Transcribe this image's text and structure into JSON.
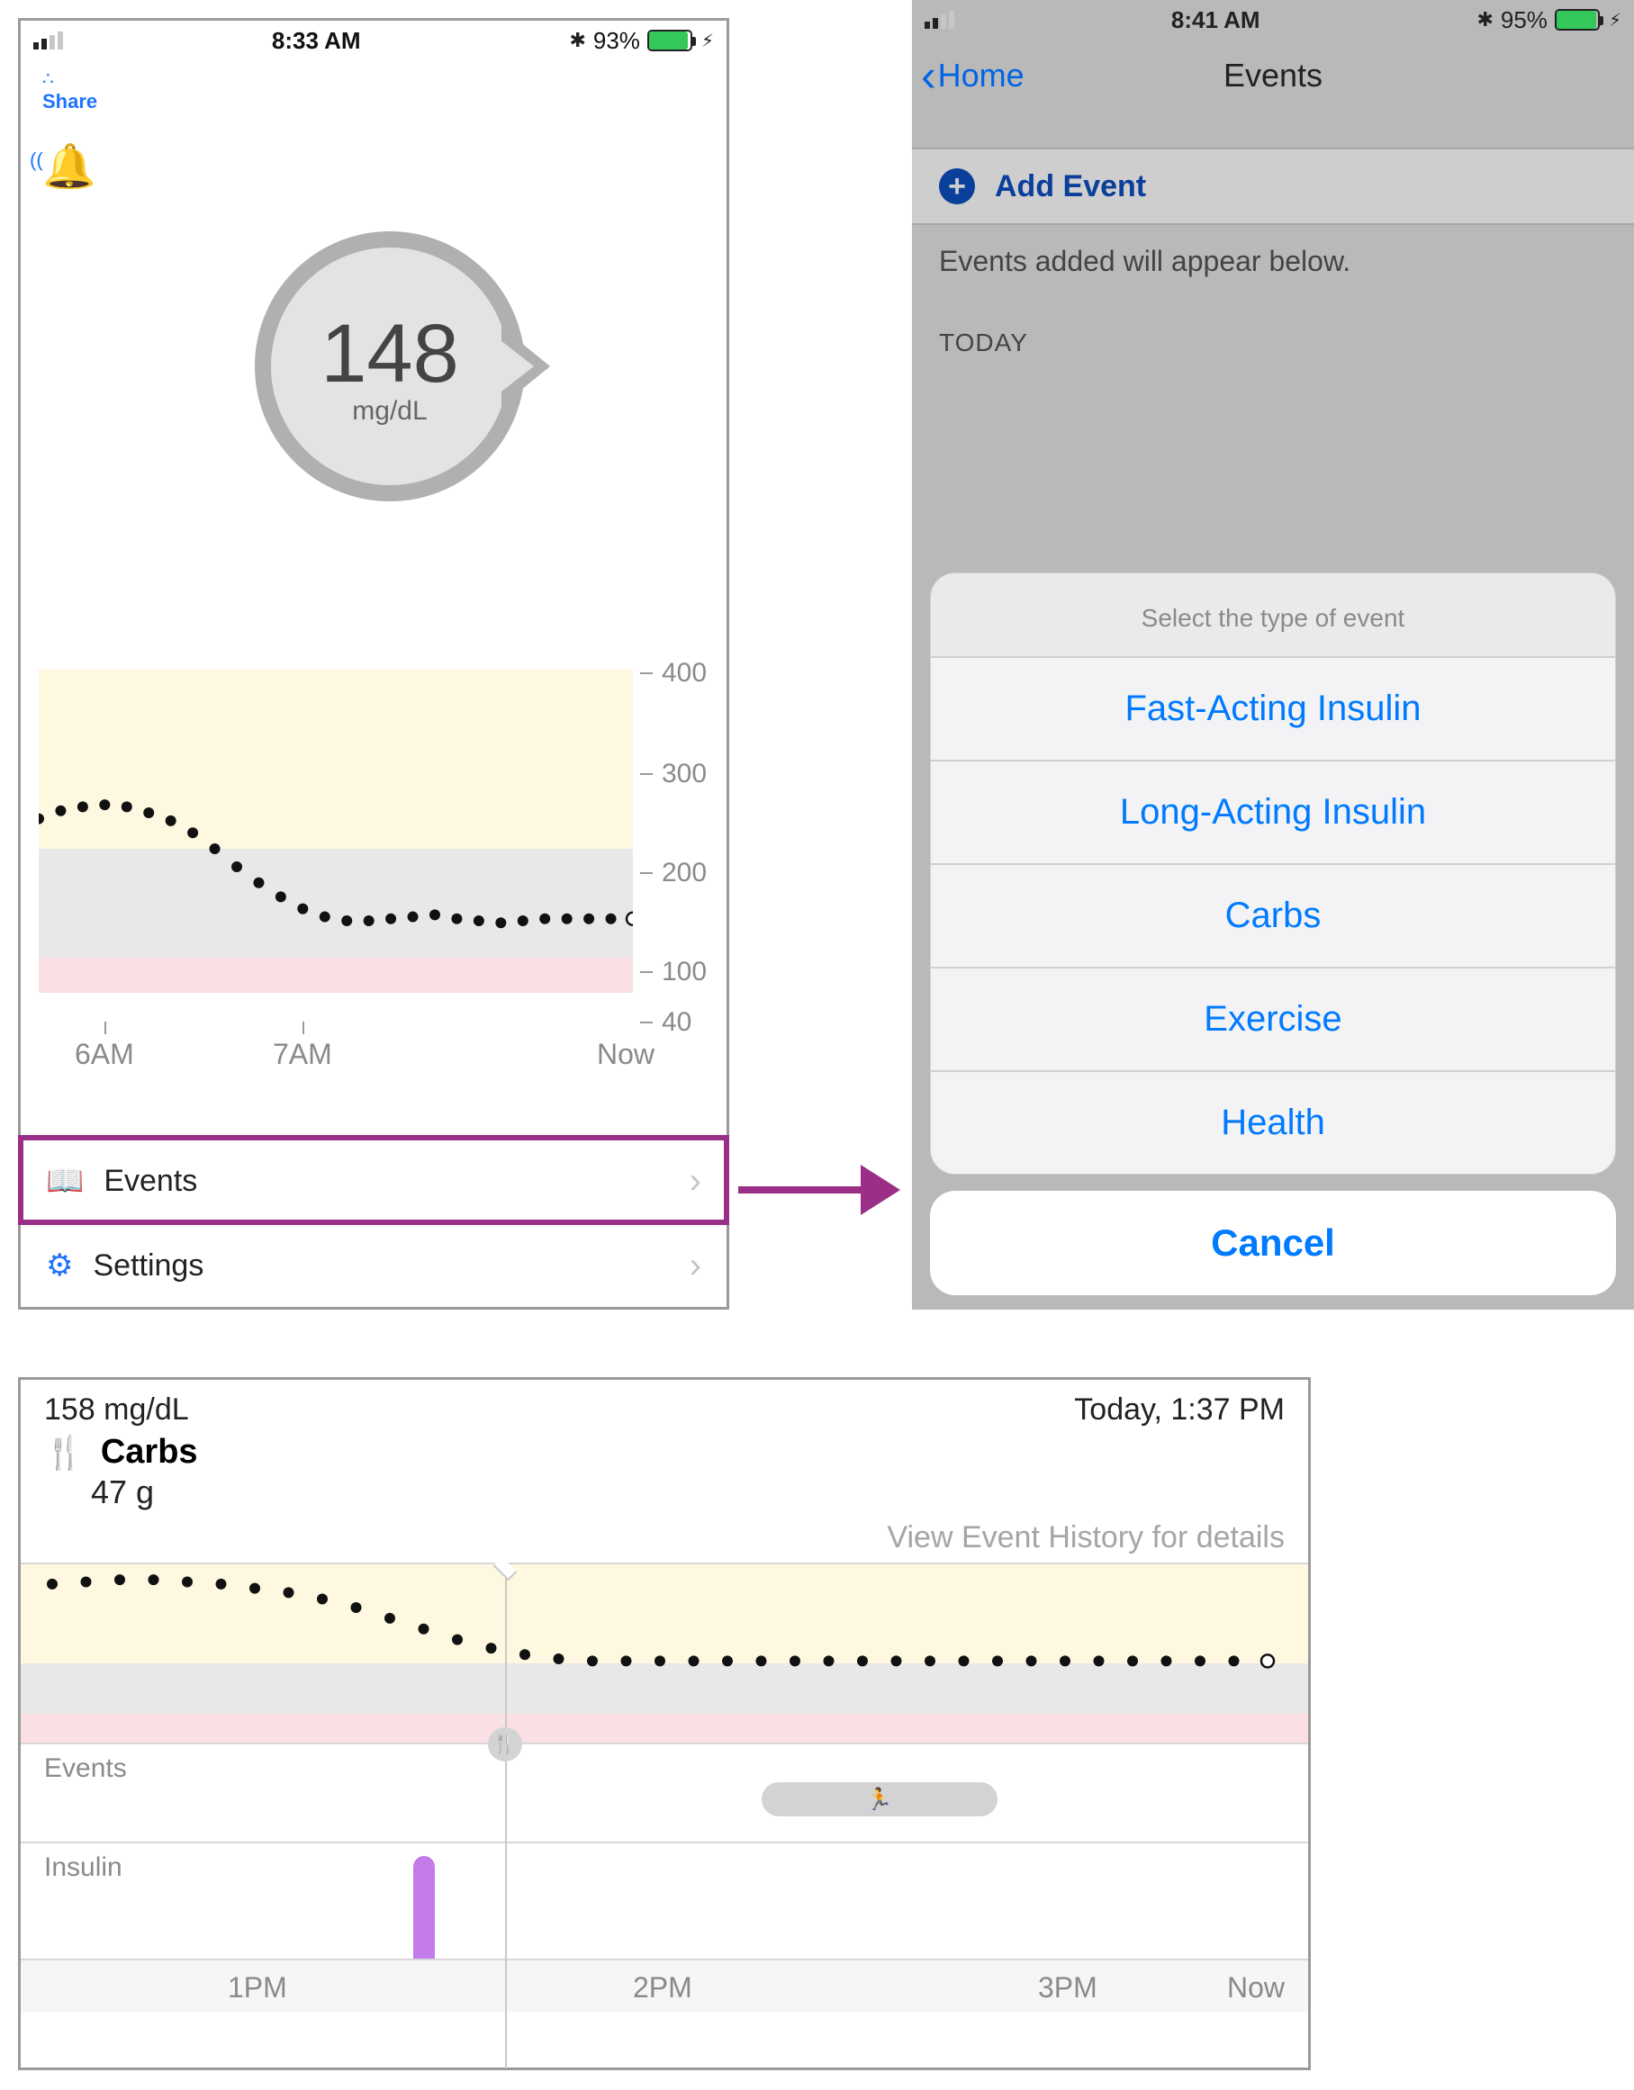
{
  "screen1": {
    "statusbar": {
      "time": "8:33 AM",
      "battery_pct": "93%",
      "battery_fill_pct": 93,
      "bluetooth": "✱"
    },
    "share_label": "Share",
    "gauge": {
      "value": "148",
      "unit": "mg/dL"
    },
    "menu": {
      "events": "Events",
      "settings": "Settings"
    }
  },
  "chart_data": [
    {
      "id": "home_trend",
      "type": "line",
      "title": "",
      "ylabel": "mg/dL",
      "ylim": [
        40,
        400
      ],
      "y_ticks": [
        40,
        100,
        200,
        300,
        400
      ],
      "x_ticks": [
        "6AM",
        "7AM",
        "Now"
      ],
      "zones": {
        "high_above": 200,
        "target": [
          100,
          200
        ],
        "low_below": 80
      },
      "series": [
        {
          "name": "glucose",
          "x_minutes_from_6am": [
            0,
            5,
            10,
            15,
            20,
            25,
            30,
            35,
            40,
            45,
            50,
            55,
            60,
            65,
            70,
            75,
            80,
            85,
            90,
            95,
            100,
            105,
            110,
            115,
            120,
            125,
            130,
            135
          ],
          "values": [
            250,
            258,
            262,
            264,
            262,
            256,
            248,
            236,
            220,
            202,
            186,
            172,
            160,
            152,
            148,
            148,
            150,
            152,
            154,
            150,
            148,
            146,
            148,
            150,
            150,
            150,
            150,
            150
          ]
        }
      ],
      "current_open_point": {
        "x_minutes_from_6am": 135,
        "value": 150
      }
    },
    {
      "id": "event_detail_trend",
      "type": "line",
      "title": "",
      "ylabel": "mg/dL",
      "x_ticks": [
        "1PM",
        "2PM",
        "3PM",
        "Now"
      ],
      "marker_time": "1:37 PM",
      "zones": {
        "high_above": 200,
        "target": [
          100,
          200
        ],
        "low_below": 80
      },
      "series": [
        {
          "name": "glucose",
          "x_minutes_from_1pm": [
            -30,
            -25,
            -20,
            -15,
            -10,
            -5,
            0,
            5,
            10,
            15,
            20,
            25,
            30,
            35,
            40,
            45,
            50,
            55,
            60,
            65,
            70,
            75,
            80,
            85,
            90,
            95,
            100,
            105,
            110,
            115,
            120,
            125,
            130,
            135,
            140,
            145,
            150
          ],
          "values": [
            230,
            232,
            234,
            234,
            232,
            230,
            226,
            222,
            216,
            208,
            198,
            188,
            178,
            170,
            164,
            160,
            158,
            158,
            158,
            158,
            158,
            158,
            158,
            158,
            158,
            158,
            158,
            158,
            158,
            158,
            158,
            158,
            158,
            158,
            158,
            158,
            158
          ]
        }
      ],
      "current_open_point": {
        "x_minutes_from_1pm": 150,
        "value": 158
      },
      "events_track": [
        {
          "type": "carbs",
          "at_minutes_from_1pm": 37
        },
        {
          "type": "exercise",
          "from_minutes_from_1pm": 75,
          "to_minutes_from_1pm": 110
        }
      ],
      "insulin_track": [
        {
          "at_minutes_from_1pm": 25,
          "relative_height": 0.95
        }
      ]
    }
  ],
  "screen2": {
    "statusbar": {
      "time": "8:41 AM",
      "battery_pct": "95%",
      "battery_fill_pct": 95
    },
    "back_label": "Home",
    "title": "Events",
    "add_label": "Add Event",
    "subtext": "Events added will appear below.",
    "today_label": "TODAY",
    "sheet": {
      "title": "Select the type of event",
      "options": [
        "Fast-Acting Insulin",
        "Long-Acting Insulin",
        "Carbs",
        "Exercise",
        "Health"
      ],
      "cancel": "Cancel"
    }
  },
  "screen3": {
    "reading": "158 mg/dL",
    "timestamp": "Today, 1:37 PM",
    "event_label": "Carbs",
    "event_value": "47 g",
    "history_hint": "View Event History for details",
    "rows": {
      "events": "Events",
      "insulin": "Insulin"
    }
  }
}
